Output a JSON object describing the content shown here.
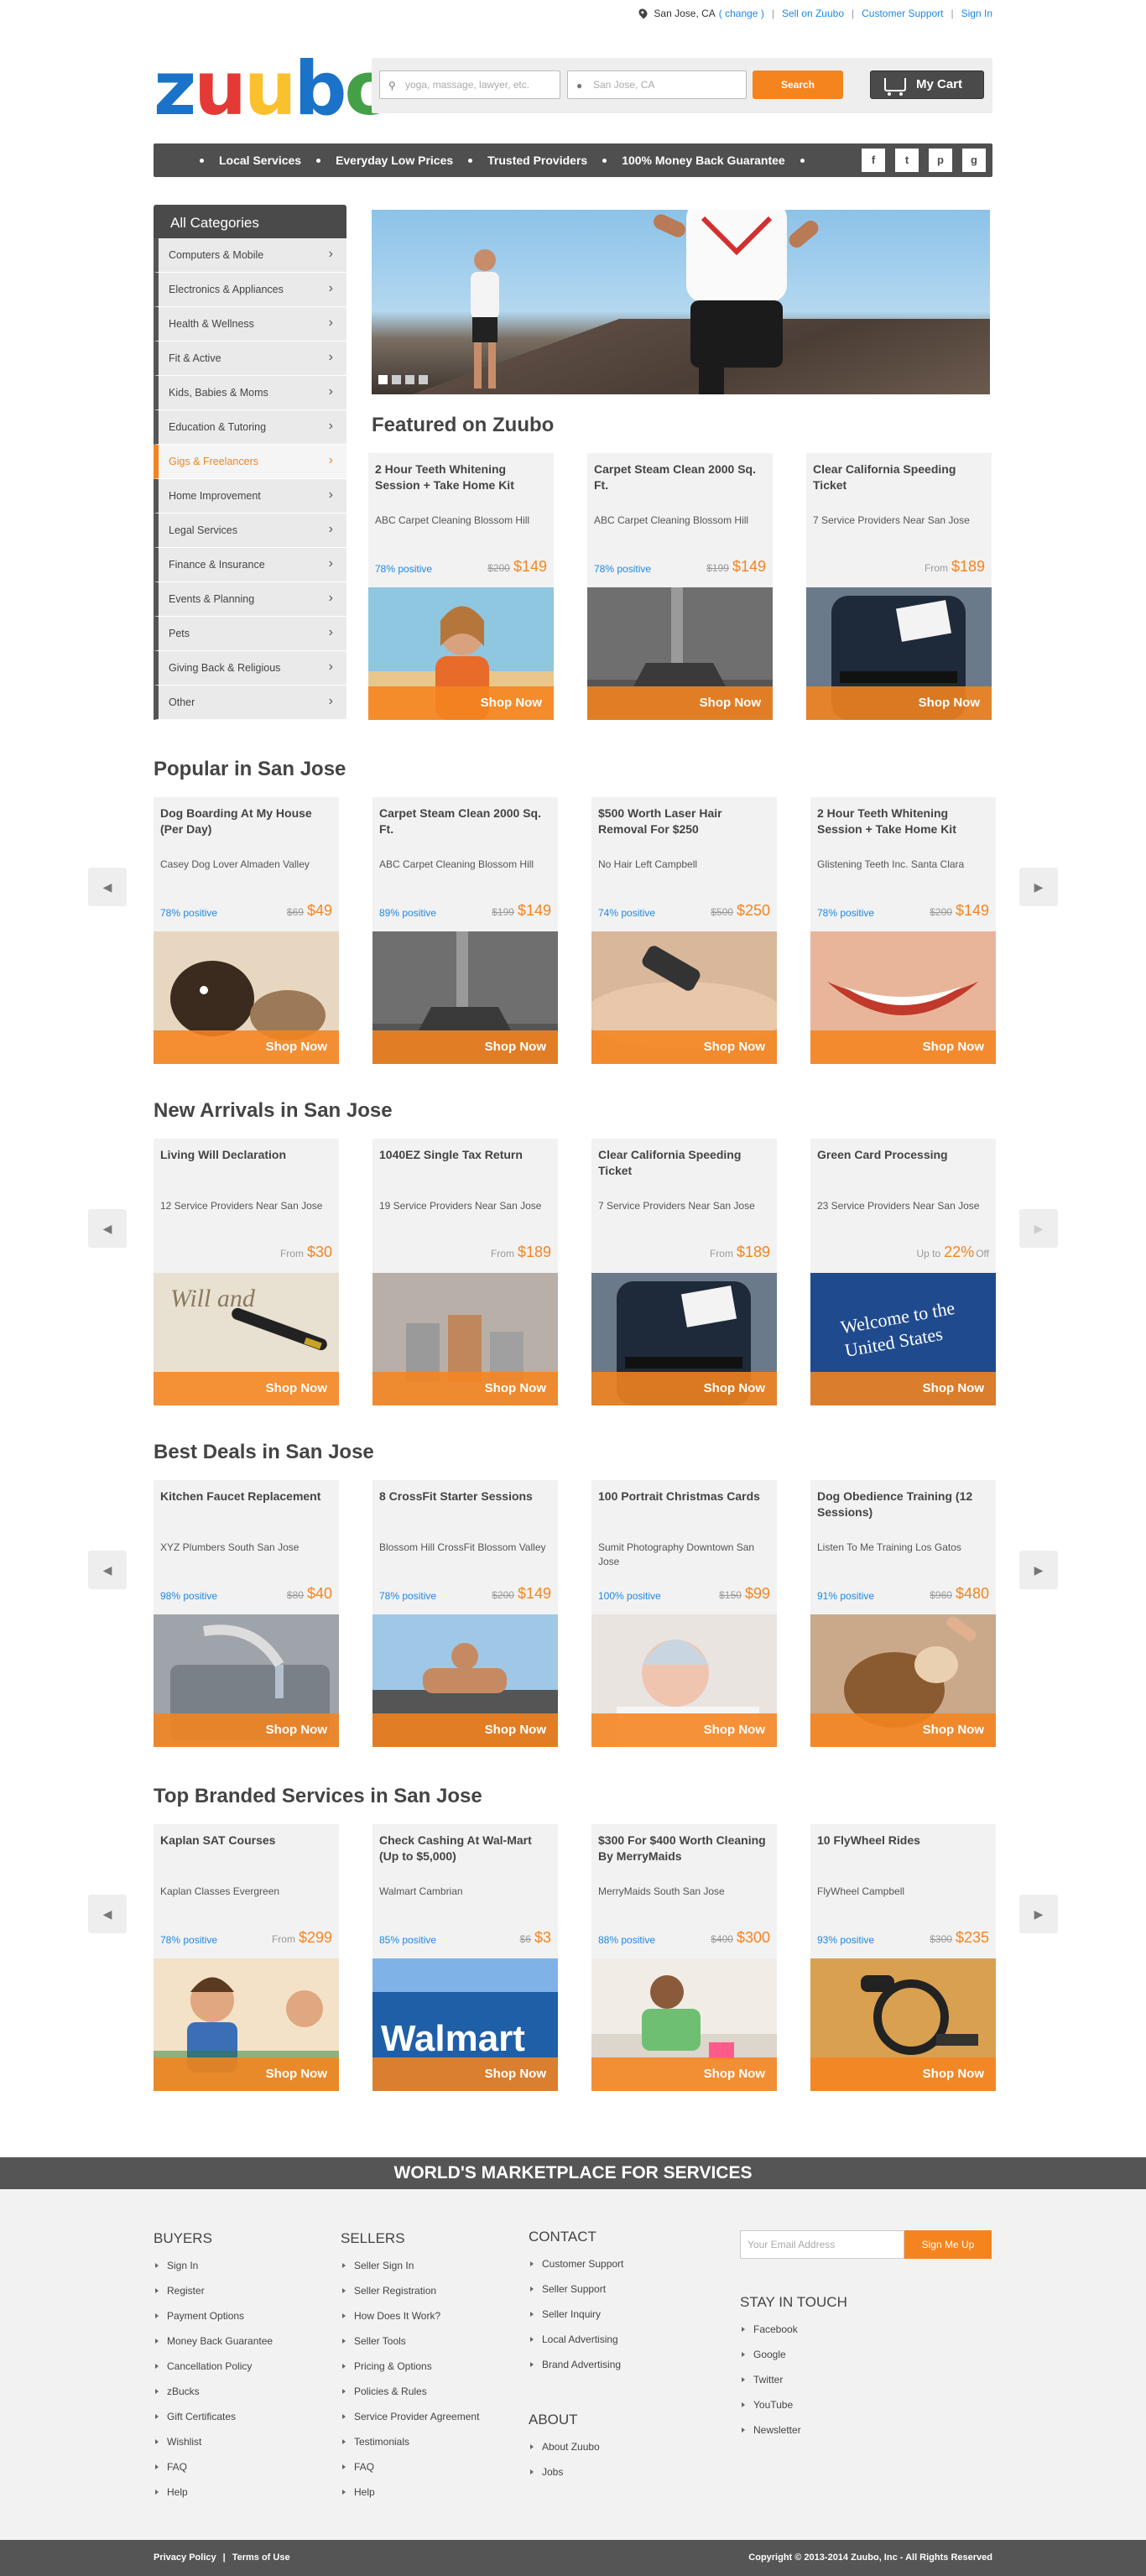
{
  "top": {
    "location": "San Jose, CA",
    "change": "( change )",
    "sell": "Sell on Zuubo",
    "support": "Customer Support",
    "signin": "Sign In"
  },
  "logo": [
    "z",
    "u",
    "u",
    "b",
    "o"
  ],
  "search": {
    "what_placeholder": "yoga, massage, lawyer, etc.",
    "where_placeholder": "San Jose, CA",
    "button": "Search",
    "cart": "My Cart"
  },
  "strip": {
    "items": [
      "Local Services",
      "Everyday Low Prices",
      "Trusted Providers",
      "100% Money Back Guarantee"
    ],
    "social": [
      "f",
      "t",
      "p",
      "g"
    ]
  },
  "sidebar": {
    "title": "All Categories",
    "items": [
      "Computers & Mobile",
      "Electronics & Appliances",
      "Health & Wellness",
      "Fit & Active",
      "Kids, Babies & Moms",
      "Education & Tutoring",
      "Gigs & Freelancers",
      "Home Improvement",
      "Legal Services",
      "Finance & Insurance",
      "Events & Planning",
      "Pets",
      "Giving Back & Religious",
      "Other"
    ]
  },
  "featured": {
    "title": "Featured on Zuubo",
    "cards": [
      {
        "title": "2 Hour Teeth Whitening Session + Take Home Kit",
        "sub": "ABC Carpet Cleaning Blossom Hill",
        "positive": "78% positive",
        "old": "$200",
        "price": "$149",
        "shop": "Shop Now",
        "img": "woman-smile"
      },
      {
        "title": "Carpet Steam Clean 2000 Sq. Ft.",
        "sub": "ABC Carpet Cleaning Blossom Hill",
        "positive": "78% positive",
        "old": "$199",
        "price": "$149",
        "shop": "Shop Now",
        "img": "vacuum"
      },
      {
        "title": "Clear California Speeding Ticket",
        "sub": "7 Service Providers Near San Jose",
        "from": "From",
        "price": "$189",
        "shop": "Shop Now",
        "img": "police"
      }
    ]
  },
  "popular": {
    "title": "Popular in San Jose",
    "cards": [
      {
        "title": "Dog Boarding At My House (Per Day)",
        "sub": "Casey Dog Lover Almaden Valley",
        "positive": "78% positive",
        "old": "$69",
        "price": "$49",
        "shop": "Shop Now",
        "img": "dog-cat"
      },
      {
        "title": "Carpet Steam Clean 2000 Sq. Ft.",
        "sub": "ABC Carpet Cleaning Blossom Hill",
        "positive": "89% positive",
        "old": "$199",
        "price": "$149",
        "shop": "Shop Now",
        "img": "vacuum"
      },
      {
        "title": "$500 Worth Laser Hair Removal For $250",
        "sub": "No Hair Left Campbell",
        "positive": "74% positive",
        "old": "$500",
        "price": "$250",
        "shop": "Shop Now",
        "img": "laser"
      },
      {
        "title": "2 Hour Teeth Whitening Session + Take Home Kit",
        "sub": "Glistening Teeth Inc. Santa Clara",
        "positive": "78% positive",
        "old": "$200",
        "price": "$149",
        "shop": "Shop Now",
        "img": "teeth"
      }
    ]
  },
  "arrivals": {
    "title": "New Arrivals in San Jose",
    "cards": [
      {
        "title": "Living Will Declaration",
        "sub": "12 Service Providers Near San Jose",
        "from": "From",
        "price": "$30",
        "shop": "Shop Now",
        "img": "will"
      },
      {
        "title": "1040EZ Single Tax Return",
        "sub": "19 Service Providers Near San Jose",
        "from": "From",
        "price": "$189",
        "shop": "Shop Now",
        "img": "coins"
      },
      {
        "title": "Clear California Speeding Ticket",
        "sub": "7 Service Providers Near San Jose",
        "from": "From",
        "price": "$189",
        "shop": "Shop Now",
        "img": "police"
      },
      {
        "title": "Green Card Processing",
        "sub": "23 Service Providers Near San Jose",
        "from": "Up to",
        "price": "22%",
        "off": "Off",
        "shop": "Shop Now",
        "img": "welcome"
      }
    ]
  },
  "deals": {
    "title": "Best Deals in San Jose",
    "cards": [
      {
        "title": "Kitchen Faucet Replacement",
        "sub": "XYZ Plumbers South San Jose",
        "positive": "98% positive",
        "old": "$80",
        "price": "$40",
        "shop": "Shop Now",
        "img": "faucet"
      },
      {
        "title": "8 CrossFit Starter Sessions",
        "sub": "Blossom Hill CrossFit Blossom Valley",
        "positive": "78% positive",
        "old": "$200",
        "price": "$149",
        "shop": "Shop Now",
        "img": "crossfit"
      },
      {
        "title": "100 Portrait Christmas Cards",
        "sub": "Sumit Photography Downtown San Jose",
        "positive": "100% positive",
        "old": "$150",
        "price": "$99",
        "shop": "Shop Now",
        "img": "baby"
      },
      {
        "title": "Dog Obedience Training (12 Sessions)",
        "sub": "Listen To Me Training Los Gatos",
        "positive": "91% positive",
        "old": "$960",
        "price": "$480",
        "shop": "Shop Now",
        "img": "dog"
      }
    ]
  },
  "branded": {
    "title": "Top Branded Services in San Jose",
    "cards": [
      {
        "title": "Kaplan SAT Courses",
        "sub": "Kaplan Classes Evergreen",
        "positive": "78% positive",
        "from": "From",
        "price": "$299",
        "shop": "Shop Now",
        "img": "kids"
      },
      {
        "title": "Check Cashing At Wal-Mart (Up to $5,000)",
        "sub": "Walmart Cambrian",
        "positive": "85% positive",
        "old": "$6",
        "price": "$3",
        "shop": "Shop Now",
        "img": "walmart",
        "walmart": "Walmart"
      },
      {
        "title": "$300 For $400 Worth Cleaning By MerryMaids",
        "sub": "MerryMaids South San Jose",
        "positive": "88% positive",
        "old": "$400",
        "price": "$300",
        "shop": "Shop Now",
        "img": "cleaning"
      },
      {
        "title": "10 FlyWheel Rides",
        "sub": "FlyWheel Campbell",
        "positive": "93% positive",
        "old": "$300",
        "price": "$235",
        "shop": "Shop Now",
        "img": "bike"
      }
    ]
  },
  "footer": {
    "band": "WORLD'S MARKETPLACE FOR SERVICES",
    "buyers": {
      "title": "BUYERS",
      "links": [
        "Sign In",
        "Register",
        "Payment Options",
        "Money Back Guarantee",
        "Cancellation Policy",
        "zBucks",
        "Gift Certificates",
        "Wishlist",
        "FAQ",
        "Help"
      ]
    },
    "sellers": {
      "title": "SELLERS",
      "links": [
        "Seller Sign In",
        "Seller Registration",
        "How Does It Work?",
        "Seller Tools",
        "Pricing & Options",
        "Policies & Rules",
        "Service Provider Agreement",
        "Testimonials",
        "FAQ",
        "Help"
      ]
    },
    "contact": {
      "title": "CONTACT",
      "links": [
        "Customer Support",
        "Seller Support",
        "Seller Inquiry",
        "Local Advertising",
        "Brand Advertising"
      ]
    },
    "about": {
      "title": "ABOUT",
      "links": [
        "About Zuubo",
        "Jobs"
      ]
    },
    "email_placeholder": "Your Email Address",
    "signup": "Sign Me Up",
    "stay": {
      "title": "STAY IN TOUCH",
      "links": [
        "Facebook",
        "Google",
        "Twitter",
        "YouTube",
        "Newsletter"
      ]
    },
    "privacy": "Privacy Policy",
    "terms": "Terms of Use",
    "copyright": "Copyright © 2013-2014 Zuubo, Inc - All Rights Reserved"
  }
}
